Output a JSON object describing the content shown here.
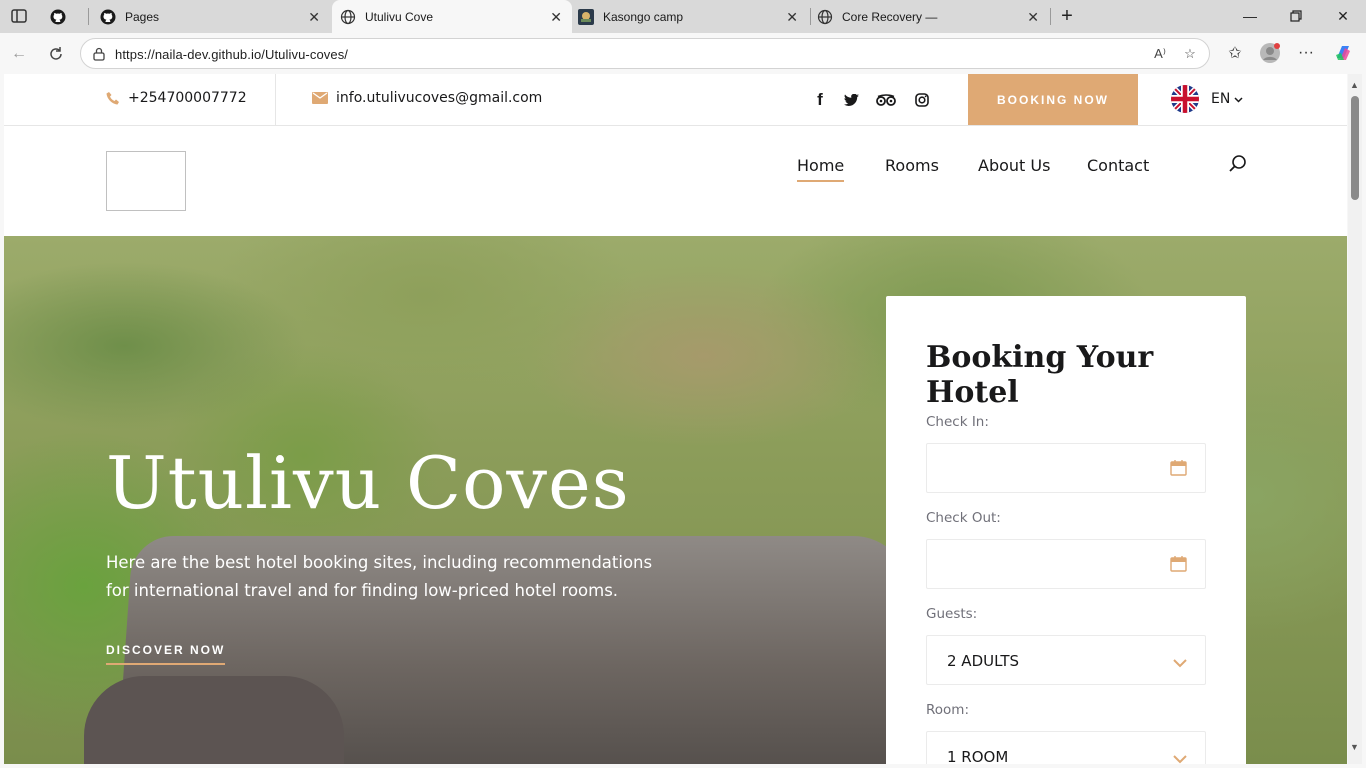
{
  "browser": {
    "tabs": [
      {
        "title": "",
        "icon": "github-icon"
      },
      {
        "title": "Pages",
        "icon": "github-icon"
      },
      {
        "title": "Utulivu Cove",
        "icon": "globe-icon",
        "active": true
      },
      {
        "title": "Kasongo camp",
        "icon": "site-favicon"
      },
      {
        "title": "Core Recovery —",
        "icon": "globe-icon"
      }
    ],
    "url": "https://naila-dev.github.io/Utulivu-coves/"
  },
  "topbar": {
    "phone": "+254700007772",
    "email": "info.utulivucoves@gmail.com",
    "social": [
      "facebook-icon",
      "twitter-icon",
      "tripadvisor-icon",
      "instagram-icon"
    ],
    "booking_button": "BOOKING NOW",
    "language": "EN"
  },
  "nav": {
    "items": [
      "Home",
      "Rooms",
      "About Us",
      "Contact"
    ],
    "active": "Home"
  },
  "hero": {
    "title": "Utulivu Coves",
    "subtitle": "Here are the best hotel booking sites, including recommendations for international travel and for finding low-priced hotel rooms.",
    "cta": "DISCOVER NOW"
  },
  "booking_form": {
    "title": "Booking Your Hotel",
    "check_in_label": "Check In:",
    "check_out_label": "Check Out:",
    "guests_label": "Guests:",
    "guests_value": "2 ADULTS",
    "room_label": "Room:",
    "room_value": "1 ROOM"
  },
  "colors": {
    "accent": "#dfa974",
    "text": "#19191a"
  }
}
